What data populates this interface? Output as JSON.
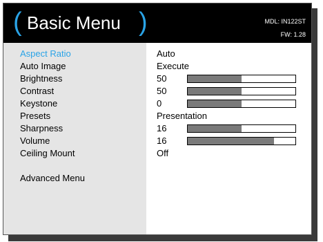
{
  "header": {
    "left_paren": "(",
    "title": "Basic Menu",
    "right_paren": ")",
    "model": "MDL: IN122ST",
    "firmware": "FW: 1.28"
  },
  "menu": {
    "items": [
      {
        "label": "Aspect Ratio",
        "value": "Auto",
        "active": true
      },
      {
        "label": "Auto Image",
        "value": "Execute"
      },
      {
        "label": "Brightness",
        "value": "50",
        "level_percent": 50
      },
      {
        "label": "Contrast",
        "value": "50",
        "level_percent": 50
      },
      {
        "label": "Keystone",
        "value": "0",
        "level_percent": 50
      },
      {
        "label": "Presets",
        "value": "Presentation"
      },
      {
        "label": "Sharpness",
        "value": "16",
        "level_percent": 50
      },
      {
        "label": "Volume",
        "value": "16",
        "level_percent": 80
      },
      {
        "label": "Ceiling Mount",
        "value": "Off"
      }
    ],
    "advanced": "Advanced Menu"
  },
  "colors": {
    "accent": "#2aa3e6",
    "header_bg": "#000000",
    "label_bg": "#e5e5e5",
    "bar_fill": "#7a7a7a"
  }
}
